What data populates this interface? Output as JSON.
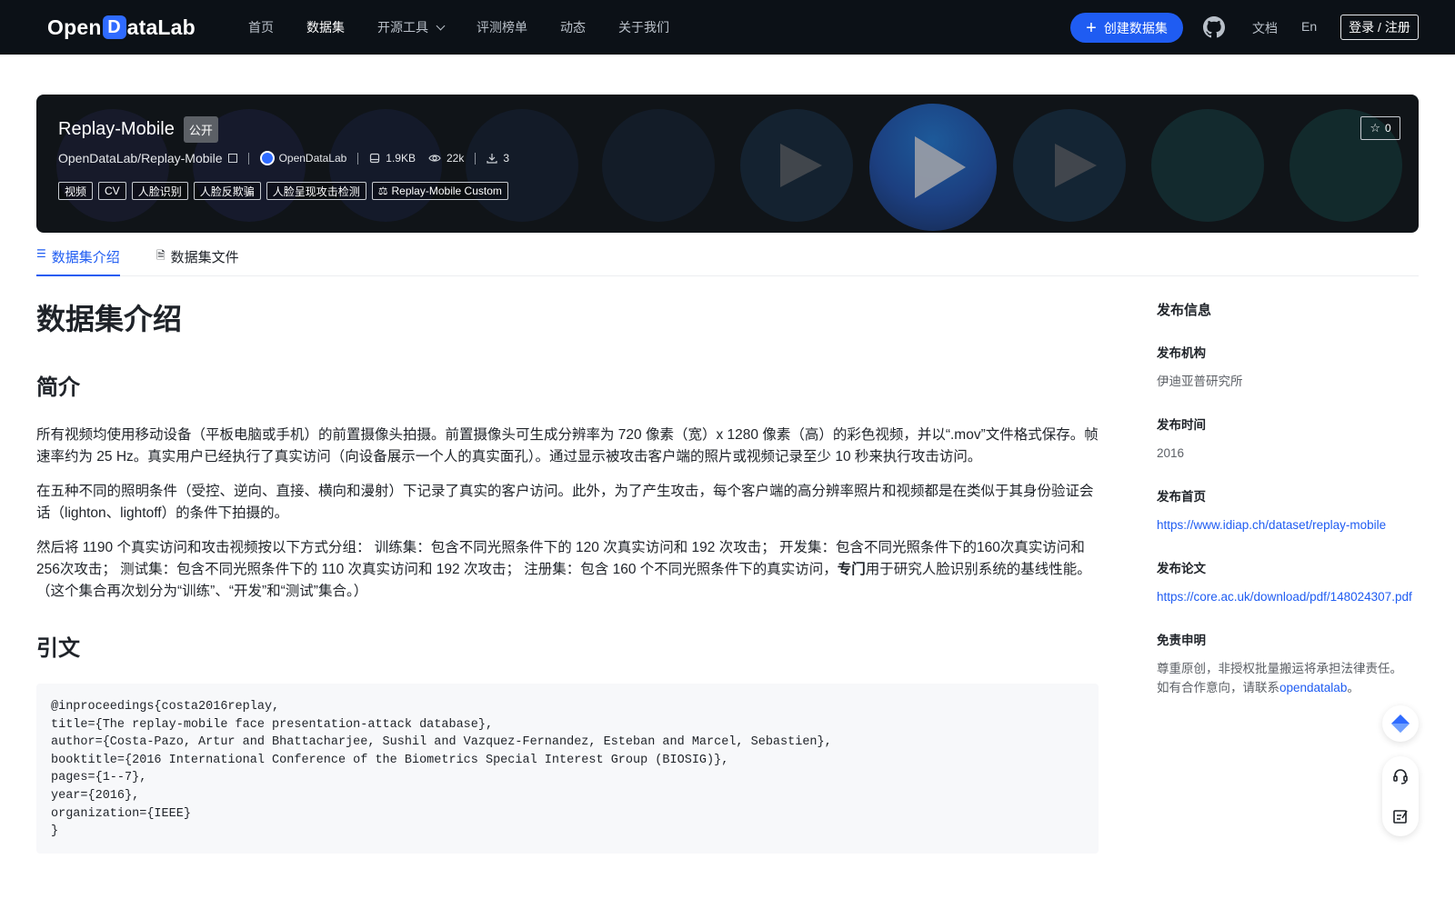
{
  "nav": {
    "logo_left": "Open",
    "logo_d": "D",
    "logo_right": "ataLab",
    "links": [
      "首页",
      "数据集",
      "开源工具",
      "评测榜单",
      "动态",
      "关于我们"
    ],
    "create_label": "创建数据集",
    "docs": "文档",
    "lang": "En",
    "login": "登录 / 注册"
  },
  "banner": {
    "title": "Replay-Mobile",
    "visibility": "公开",
    "repo": "OpenDataLab/Replay-Mobile",
    "org": "OpenDataLab",
    "size": "1.9KB",
    "views": "22k",
    "downloads": "3",
    "tags": [
      "视频",
      "CV",
      "人脸识别",
      "人脸反欺骗",
      "人脸呈现攻击检测"
    ],
    "license": "Replay-Mobile Custom",
    "stars": "0"
  },
  "tabs": [
    "数据集介绍",
    "数据集文件"
  ],
  "main": {
    "title": "数据集介绍",
    "intro_heading": "简介",
    "p1": "所有视频均使用移动设备（平板电脑或手机）的前置摄像头拍摄。前置摄像头可生成分辨率为 720 像素（宽）x 1280 像素（高）的彩色视频，并以“.mov”文件格式保存。帧速率约为 25 Hz。真实用户已经执行了真实访问（向设备展示一个人的真实面孔）。通过显示被攻击客户端的照片或视频记录至少 10 秒来执行攻击访问。",
    "p2": "在五种不同的照明条件（受控、逆向、直接、横向和漫射）下记录了真实的客户访问。此外，为了产生攻击，每个客户端的高分辨率照片和视频都是在类似于其身份验证会话（lighton、lightoff）的条件下拍摄的。",
    "p3_a": "然后将 1190 个真实访问和攻击视频按以下方式分组： 训练集：包含不同光照条件下的 120 次真实访问和 192 次攻击； 开发集：包含不同光照条件下的160次真实访问和256次攻击； 测试集：包含不同光照条件下的 110 次真实访问和 192 次攻击； 注册集：包含 160 个不同光照条件下的真实访问，",
    "p3_bold": "专门",
    "p3_b": "用于研究人脸识别系统的基线性能。 （这个集合再次划分为“训练”、“开发”和“测试”集合。）",
    "cite_heading": "引文",
    "citation": "@inproceedings{costa2016replay,\ntitle={The replay-mobile face presentation-attack database},\nauthor={Costa-Pazo, Artur and Bhattacharjee, Sushil and Vazquez-Fernandez, Esteban and Marcel, Sebastien},\nbooktitle={2016 International Conference of the Biometrics Special Interest Group (BIOSIG)},\npages={1--7},\nyear={2016},\norganization={IEEE}\n}"
  },
  "side": {
    "heading": "发布信息",
    "org_label": "发布机构",
    "org_value": "伊迪亚普研究所",
    "time_label": "发布时间",
    "time_value": "2016",
    "home_label": "发布首页",
    "home_value": "https://www.idiap.ch/dataset/replay-mobile",
    "paper_label": "发布论文",
    "paper_value": "https://core.ac.uk/download/pdf/148024307.pdf",
    "disclaimer_label": "免责申明",
    "disclaimer_1": "尊重原创，非授权批量搬运将承担法律责任。",
    "disclaimer_2a": "如有合作意向，请联系",
    "disclaimer_link": "opendatalab",
    "disclaimer_2b": "。"
  },
  "colors": {
    "nav_bg": "#0c1117",
    "accent": "#1f5cf2",
    "banner_bg": "#101418"
  }
}
